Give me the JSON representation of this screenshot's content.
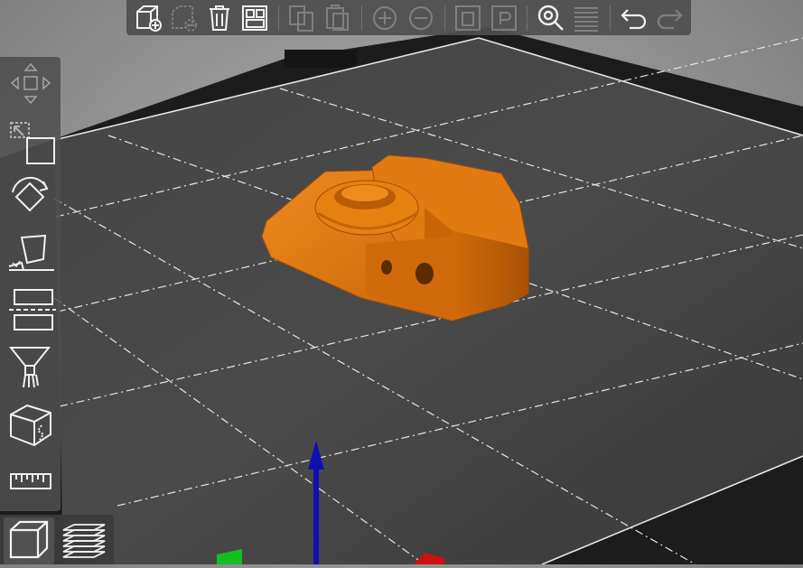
{
  "app": {
    "colors": {
      "model": "#e07a12",
      "bed": "#3f3f3f",
      "bed_frame": "#1a1a1a",
      "grid": "#e8e8e8",
      "axis_z": "#1010b0",
      "axis_y": "#10c020",
      "axis_x": "#d01010",
      "toolbar_bg": "#4e4e4e",
      "icon": "#f2f2f2"
    }
  },
  "top_toolbar": {
    "buttons": [
      {
        "name": "add-object-button",
        "icon": "cube-plus-icon",
        "enabled": true
      },
      {
        "name": "delete-button",
        "icon": "cube-minus-icon",
        "enabled": false
      },
      {
        "name": "delete-all-button",
        "icon": "trash-icon",
        "enabled": true
      },
      {
        "name": "arrange-button",
        "icon": "arrange-icon",
        "enabled": true
      },
      {
        "name": "copy-button",
        "icon": "copy-icon",
        "enabled": false
      },
      {
        "name": "paste-button",
        "icon": "paste-icon",
        "enabled": false
      },
      {
        "name": "add-instance-button",
        "icon": "plus-circle-icon",
        "enabled": false
      },
      {
        "name": "remove-instance-button",
        "icon": "minus-circle-icon",
        "enabled": false
      },
      {
        "name": "split-objects-button",
        "icon": "split-objects-icon",
        "enabled": false
      },
      {
        "name": "split-parts-button",
        "icon": "split-parts-icon",
        "enabled": false
      },
      {
        "name": "search-button",
        "icon": "search-icon",
        "enabled": true
      },
      {
        "name": "layers-button",
        "icon": "layers-icon",
        "enabled": false
      },
      {
        "name": "undo-button",
        "icon": "undo-icon",
        "enabled": true
      },
      {
        "name": "redo-button",
        "icon": "redo-icon",
        "enabled": false
      }
    ]
  },
  "left_toolbar": {
    "tools": [
      {
        "name": "move-tool",
        "icon": "move-icon"
      },
      {
        "name": "scale-tool",
        "icon": "scale-icon"
      },
      {
        "name": "rotate-tool",
        "icon": "rotate-icon"
      },
      {
        "name": "place-on-face-tool",
        "icon": "place-on-face-icon"
      },
      {
        "name": "cut-tool",
        "icon": "cut-icon"
      },
      {
        "name": "paint-supports-tool",
        "icon": "paint-supports-icon"
      },
      {
        "name": "seam-painting-tool",
        "icon": "seam-icon"
      },
      {
        "name": "measure-tool",
        "icon": "ruler-icon"
      }
    ]
  },
  "view_toolbar": {
    "views": [
      {
        "name": "3d-view-button",
        "icon": "cube-view-icon",
        "active": true
      },
      {
        "name": "preview-button",
        "icon": "layers-view-icon",
        "active": false
      }
    ]
  }
}
